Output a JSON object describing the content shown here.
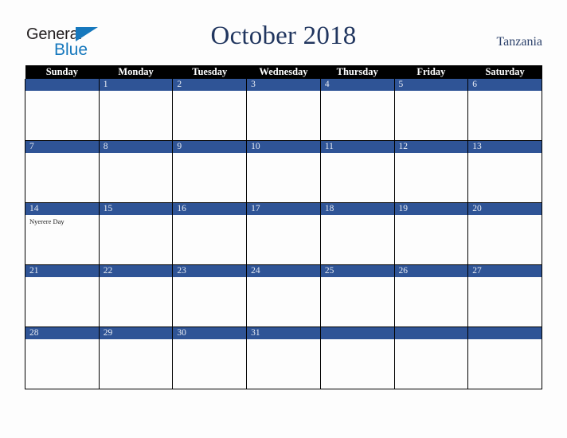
{
  "brand": {
    "name_part1": "General",
    "name_part2": "Blue",
    "accent_color": "#1678bd"
  },
  "header": {
    "title": "October 2018",
    "country": "Tanzania"
  },
  "theme": {
    "day_band_color": "#2f5496",
    "header_row_color": "#000000",
    "page_background": "#fdfdfd",
    "title_color": "#21365f"
  },
  "calendar": {
    "weekday_headers": [
      "Sunday",
      "Monday",
      "Tuesday",
      "Wednesday",
      "Thursday",
      "Friday",
      "Saturday"
    ],
    "weeks": [
      [
        {
          "day": "",
          "events": []
        },
        {
          "day": "1",
          "events": []
        },
        {
          "day": "2",
          "events": []
        },
        {
          "day": "3",
          "events": []
        },
        {
          "day": "4",
          "events": []
        },
        {
          "day": "5",
          "events": []
        },
        {
          "day": "6",
          "events": []
        }
      ],
      [
        {
          "day": "7",
          "events": []
        },
        {
          "day": "8",
          "events": []
        },
        {
          "day": "9",
          "events": []
        },
        {
          "day": "10",
          "events": []
        },
        {
          "day": "11",
          "events": []
        },
        {
          "day": "12",
          "events": []
        },
        {
          "day": "13",
          "events": []
        }
      ],
      [
        {
          "day": "14",
          "events": [
            "Nyerere Day"
          ]
        },
        {
          "day": "15",
          "events": []
        },
        {
          "day": "16",
          "events": []
        },
        {
          "day": "17",
          "events": []
        },
        {
          "day": "18",
          "events": []
        },
        {
          "day": "19",
          "events": []
        },
        {
          "day": "20",
          "events": []
        }
      ],
      [
        {
          "day": "21",
          "events": []
        },
        {
          "day": "22",
          "events": []
        },
        {
          "day": "23",
          "events": []
        },
        {
          "day": "24",
          "events": []
        },
        {
          "day": "25",
          "events": []
        },
        {
          "day": "26",
          "events": []
        },
        {
          "day": "27",
          "events": []
        }
      ],
      [
        {
          "day": "28",
          "events": []
        },
        {
          "day": "29",
          "events": []
        },
        {
          "day": "30",
          "events": []
        },
        {
          "day": "31",
          "events": []
        },
        {
          "day": "",
          "events": []
        },
        {
          "day": "",
          "events": []
        },
        {
          "day": "",
          "events": []
        }
      ]
    ]
  }
}
